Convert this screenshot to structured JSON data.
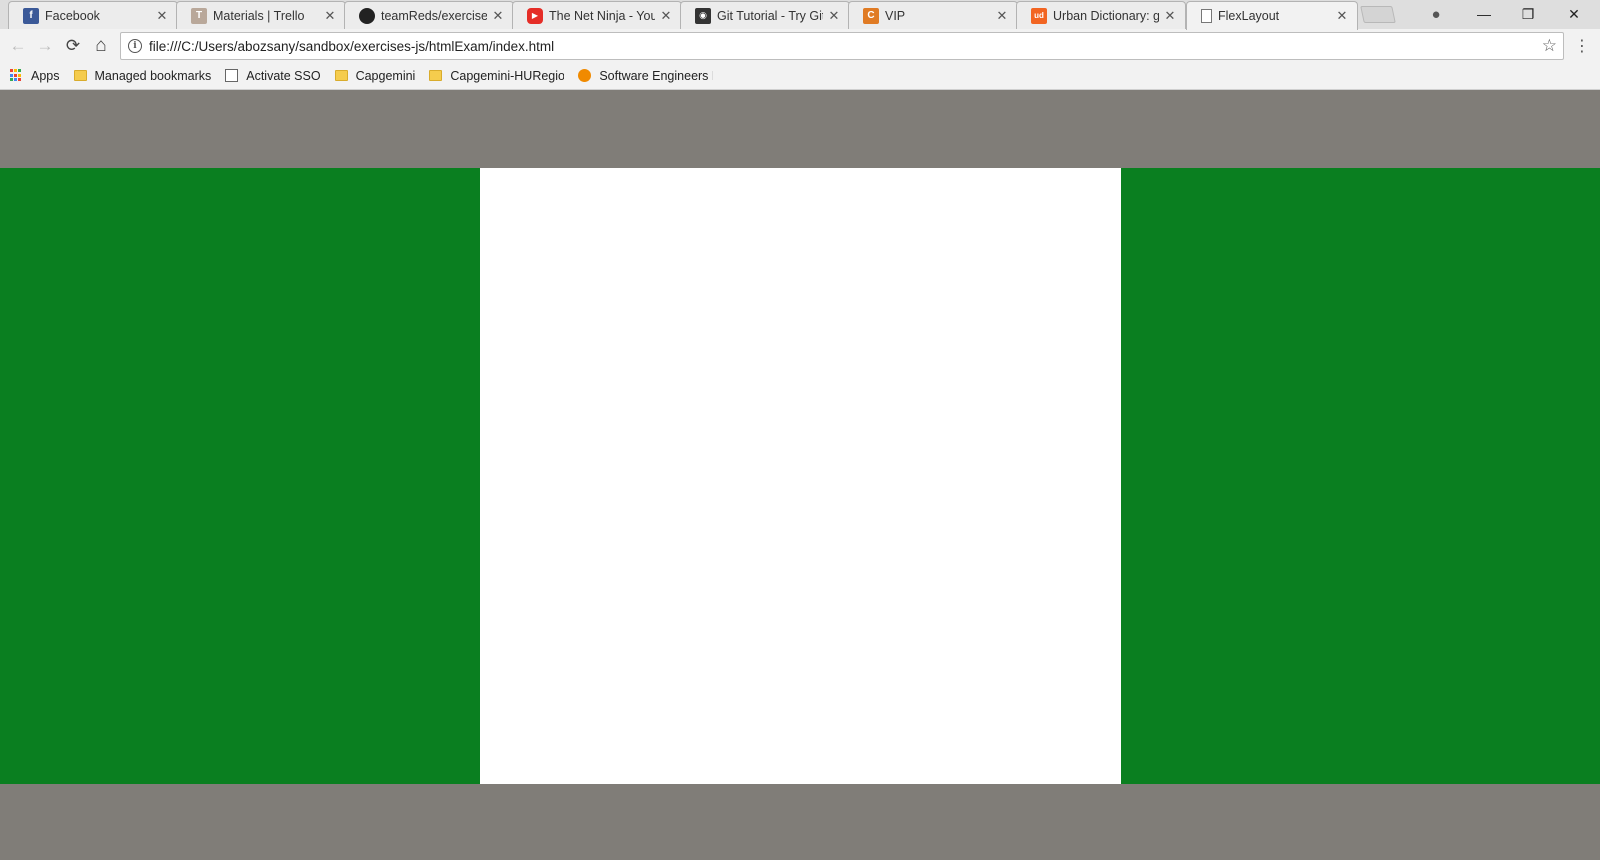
{
  "browser": {
    "tabs": [
      {
        "title": "Facebook",
        "favicon": "facebook-icon",
        "favicon_color": "#3b5998",
        "favicon_glyph": "f",
        "active": false
      },
      {
        "title": "Materials | Trello",
        "favicon": "trello-icon",
        "favicon_color": "#b9a89a",
        "favicon_glyph": "T",
        "active": false
      },
      {
        "title": "teamReds/exercises",
        "favicon": "github-icon",
        "favicon_color": "#222222",
        "favicon_glyph": "●",
        "active": false
      },
      {
        "title": "The Net Ninja - You",
        "favicon": "youtube-icon",
        "favicon_color": "#e52d27",
        "favicon_glyph": "▶",
        "active": false
      },
      {
        "title": "Git Tutorial - Try Git",
        "favicon": "octocat-icon",
        "favicon_color": "#333333",
        "favicon_glyph": "◉",
        "active": false
      },
      {
        "title": "VIP",
        "favicon": "codecademy-icon",
        "favicon_color": "#e07b24",
        "favicon_glyph": "C",
        "active": false
      },
      {
        "title": "Urban Dictionary: g",
        "favicon": "urban-dictionary-icon",
        "favicon_color": "#f26522",
        "favicon_glyph": "ud",
        "active": false
      },
      {
        "title": "FlexLayout",
        "favicon": "page-icon",
        "favicon_color": "#ffffff",
        "favicon_glyph": "",
        "active": true
      }
    ],
    "toolbar": {
      "back_icon": "←",
      "forward_icon": "→",
      "reload_icon": "⟳",
      "home_icon": "⌂",
      "info_icon": "i",
      "url": "file:///C:/Users/abozsany/sandbox/exercises-js/htmlExam/index.html",
      "star_icon": "☆",
      "menu_icon": "⋮"
    },
    "window_controls": {
      "profile_icon": "●",
      "minimize_icon": "—",
      "restore_icon": "❐",
      "close_icon": "✕"
    },
    "bookmarks": [
      {
        "label": "Apps",
        "icon": "apps-grid-icon"
      },
      {
        "label": "Managed bookmarks",
        "icon": "folder-icon"
      },
      {
        "label": "Activate SSO",
        "icon": "page-icon"
      },
      {
        "label": "Capgemini",
        "icon": "folder-icon"
      },
      {
        "label": "Capgemini-HURegio",
        "icon": "folder-icon"
      },
      {
        "label": "Software Engineers L",
        "icon": "orange-circle-icon"
      }
    ]
  },
  "page": {
    "colors": {
      "header": "#807d78",
      "left_column": "#0a7f20",
      "center_column": "#ffffff",
      "right_column": "#0a7f20",
      "footer": "#807d78"
    }
  }
}
